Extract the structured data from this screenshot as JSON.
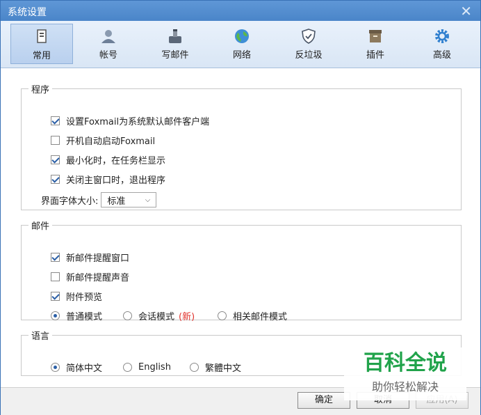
{
  "window": {
    "title": "系统设置"
  },
  "tabs": [
    {
      "label": "常用",
      "icon": "general-icon",
      "active": true
    },
    {
      "label": "帐号",
      "icon": "account-icon"
    },
    {
      "label": "写邮件",
      "icon": "compose-icon"
    },
    {
      "label": "网络",
      "icon": "network-icon"
    },
    {
      "label": "反垃圾",
      "icon": "shield-icon"
    },
    {
      "label": "插件",
      "icon": "plugin-icon"
    },
    {
      "label": "高级",
      "icon": "gear-icon"
    }
  ],
  "program": {
    "legend": "程序",
    "opt1": "设置Foxmail为系统默认邮件客户端",
    "opt2": "开机自动启动Foxmail",
    "opt3": "最小化时，在任务栏显示",
    "opt4": "关闭主窗口时，退出程序",
    "font_label": "界面字体大小:",
    "font_value": "标准"
  },
  "mail": {
    "legend": "邮件",
    "opt1": "新邮件提醒窗口",
    "opt2": "新邮件提醒声音",
    "opt3": "附件预览",
    "mode1": "普通模式",
    "mode2": "会话模式",
    "mode2_tag": "(新)",
    "mode3": "相关邮件模式"
  },
  "language": {
    "legend": "语言",
    "opt1": "简体中文",
    "opt2": "English",
    "opt3": "繁體中文"
  },
  "footer": {
    "ok": "确定",
    "cancel": "取消",
    "apply": "应用(A)"
  },
  "watermark": {
    "main": "百科全说",
    "sub": "助你轻松解决"
  },
  "colors": {
    "accent": "#2b5fa6",
    "title_bar": "#4a85c9",
    "new_tag": "#e0312b",
    "watermark": "#21a34b"
  }
}
